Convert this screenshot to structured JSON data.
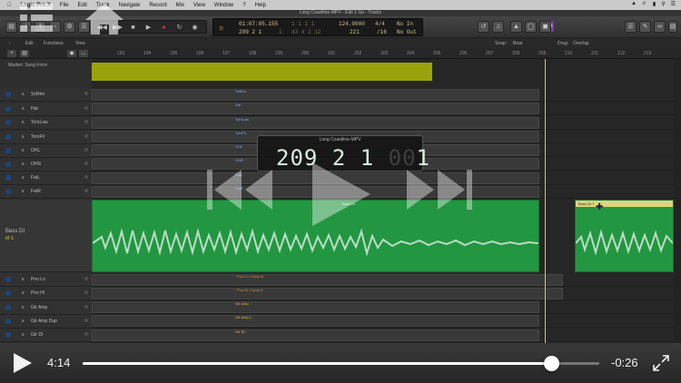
{
  "menubar": {
    "app": "Logic Pro X",
    "items": [
      "File",
      "Edit",
      "Track",
      "Navigate",
      "Record",
      "Mix",
      "View",
      "Window",
      "?",
      "Help"
    ]
  },
  "window": {
    "title": "Long Coastline-MPV - Edit 1 Go - Tracks"
  },
  "lcd": {
    "position_time": "01:07:05.155",
    "position_bars": "209  2  1",
    "position_sub": "1",
    "tempo": "124.0000",
    "tempo_sub": "221",
    "signature": "4/4",
    "division": "/16",
    "in_label": "No In",
    "out_label": "No Out",
    "extra_top": "1  1  1  1",
    "extra_bottom": "43  4  2  12"
  },
  "cpu_label": "−124",
  "editbar": {
    "edit": "Edit",
    "functions": "Functions",
    "view": "View",
    "snap_label": "Snap:",
    "snap_value": "Beat",
    "drag_label": "Drag:",
    "drag_value": "Overlap"
  },
  "marker": {
    "label": "Marker: Song Form"
  },
  "ruler": [
    "193",
    "194",
    "195",
    "196",
    "197",
    "198",
    "199",
    "200",
    "201",
    "202",
    "203",
    "204",
    "205",
    "206",
    "207",
    "208",
    "209",
    "210",
    "211",
    "212",
    "213"
  ],
  "tracks": [
    {
      "name": "SnBtm",
      "region": "SnBtm"
    },
    {
      "name": "Hat",
      "region": "Hat"
    },
    {
      "name": "TomLow",
      "region": "TomLow"
    },
    {
      "name": "TomFlr",
      "region": "TomFlr"
    },
    {
      "name": "OHL",
      "region": "OHL"
    },
    {
      "name": "OHR",
      "region": "OHR"
    },
    {
      "name": "FatL",
      "region": "FatL"
    },
    {
      "name": "FatR",
      "region": "FatR"
    }
  ],
  "bass": {
    "name": "Bass DI",
    "buttons": "M S",
    "region": "Bass DI",
    "region2": "Bass DI.7"
  },
  "tracks_lower": [
    {
      "name": "Pno Lo",
      "region": "Pno Lo: Comp A",
      "color": "orange"
    },
    {
      "name": "Pno Hi",
      "region": "Pno Hi: Comp A",
      "color": "orange"
    },
    {
      "name": "Gtr Amp",
      "region": "Gtr Amp",
      "color": "yellow"
    },
    {
      "name": "Gtr Amp Dup",
      "region": "Gtr Amp.1",
      "color": "yellow"
    },
    {
      "name": "Gtr DI",
      "region": "Gtr DI",
      "color": "yellow"
    }
  ],
  "timecode_overlay": {
    "title": "Long Coastline-MPV",
    "bar": "209",
    "beat": "2",
    "div": "1",
    "dim_a": "00",
    "dim_b": "00",
    "tick": "1"
  },
  "player": {
    "elapsed": "4:14",
    "remaining": "-0:26",
    "progress": 0.907
  },
  "colors": {
    "accent_green": "#26a347",
    "marker_yellow": "#a6b20c",
    "playhead": "#f0d93b"
  }
}
